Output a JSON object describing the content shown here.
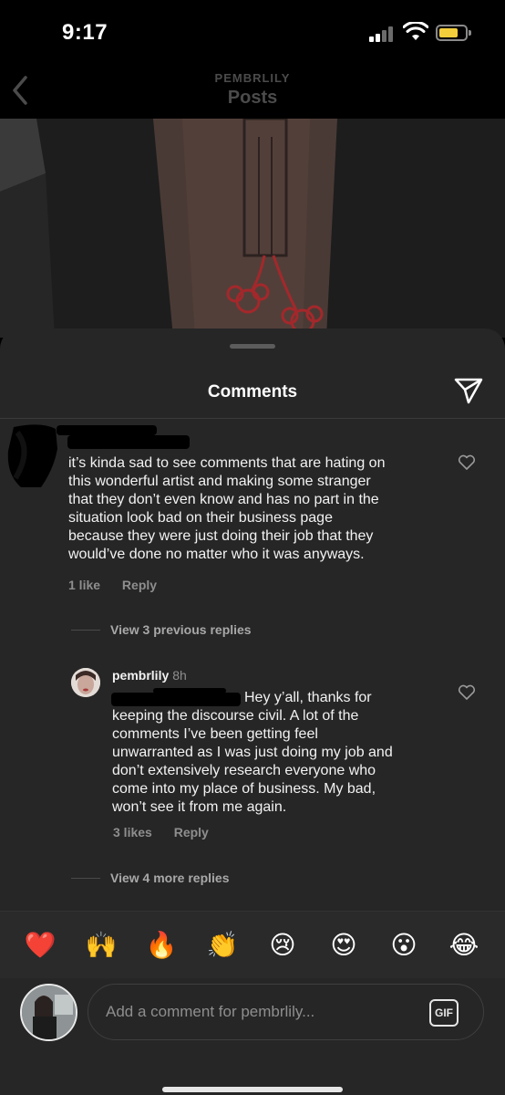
{
  "status": {
    "time": "9:17"
  },
  "header": {
    "account": "PEMBRLILY",
    "title": "Posts"
  },
  "comments_sheet": {
    "title": "Comments"
  },
  "comment": {
    "lines": [
      "it’s kinda sad to see comments that are hating on",
      "this wonderful artist and making some stranger",
      "that they don’t even know and has no part in the",
      "situation look bad on their business page",
      "because they were just doing their job that they",
      "would’ve done no matter who it was anyways."
    ],
    "likes": "1 like",
    "reply_label": "Reply"
  },
  "view_previous": "View 3 previous replies",
  "reply": {
    "username": "pembrlily",
    "time_ago": "8h",
    "lines": [
      "Hey y’all, thanks for",
      "keeping the discourse civil. A lot of the",
      "comments I’ve been getting feel",
      "unwarranted as I was just doing my job and",
      "don’t extensively research everyone who",
      "come into my place of business. My bad,",
      "won’t see it from me again."
    ],
    "likes": "3 likes",
    "reply_label": "Reply"
  },
  "view_more": "View 4 more replies",
  "emoji_bar": [
    {
      "glyph": "❤️",
      "icon": "red-heart-emoji"
    },
    {
      "glyph": "🙌",
      "icon": "raising-hands-emoji"
    },
    {
      "glyph": "🔥",
      "icon": "fire-emoji"
    },
    {
      "glyph": "👏",
      "icon": "clapping-hands-emoji"
    },
    {
      "glyph": "😢",
      "icon": "crying-face-emoji"
    },
    {
      "glyph": "😍",
      "icon": "heart-eyes-emoji"
    },
    {
      "glyph": "😮",
      "icon": "surprised-face-emoji"
    },
    {
      "glyph": "😂",
      "icon": "tears-of-joy-emoji"
    }
  ],
  "composer": {
    "placeholder": "Add a comment for pembrlily...",
    "gif_label": "GIF"
  },
  "colors": {
    "background": "#000000",
    "sheet": "#262626",
    "text": "#f2f2f2",
    "muted": "#8e8e8e",
    "battery": "#f4cf3c"
  }
}
